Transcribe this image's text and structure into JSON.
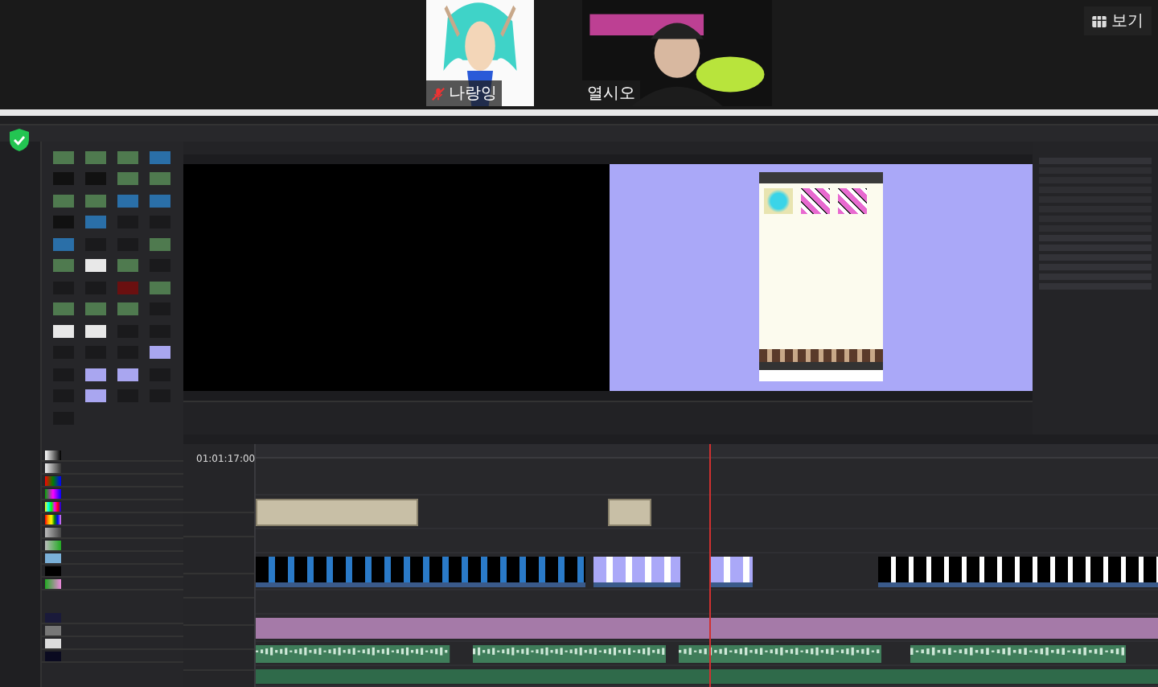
{
  "participants": [
    {
      "name": "나랑잉",
      "muted": true
    },
    {
      "name": "열시오",
      "muted": false
    }
  ],
  "view_button": {
    "label": "보기"
  },
  "timeline": {
    "timecode": "01:01:17:00"
  }
}
